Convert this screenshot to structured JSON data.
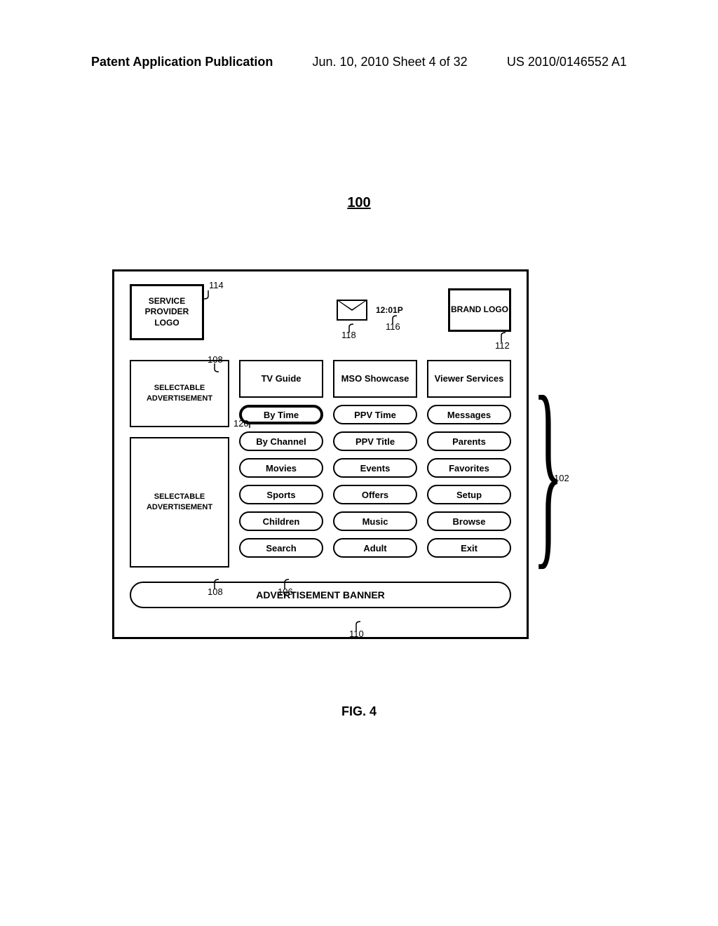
{
  "header": {
    "left": "Patent Application Publication",
    "center": "Jun. 10, 2010  Sheet 4 of 32",
    "right": "US 2010/0146552 A1"
  },
  "figure_ref": "100",
  "figure_label": "FIG. 4",
  "top": {
    "service_logo": "SERVICE PROVIDER LOGO",
    "clock": "12:01P",
    "brand_logo": "BRAND LOGO"
  },
  "ads": {
    "top": "SELECTABLE ADVERTISEMENT",
    "bottom": "SELECTABLE ADVERTISEMENT"
  },
  "columns": [
    {
      "header": "TV Guide",
      "items": [
        "By Time",
        "By Channel",
        "Movies",
        "Sports",
        "Children",
        "Search"
      ],
      "selected_index": 0
    },
    {
      "header": "MSO Showcase",
      "items": [
        "PPV Time",
        "PPV Title",
        "Events",
        "Offers",
        "Music",
        "Adult"
      ],
      "selected_index": -1
    },
    {
      "header": "Viewer Services",
      "items": [
        "Messages",
        "Parents",
        "Favorites",
        "Setup",
        "Browse",
        "Exit"
      ],
      "selected_index": -1
    }
  ],
  "banner": "ADVERTISEMENT BANNER",
  "refs": {
    "r114": "114",
    "r118": "118",
    "r116": "116",
    "r112": "112",
    "r108a": "108",
    "r120": "120",
    "r102": "102",
    "r108b": "108",
    "r106": "106",
    "r110": "110"
  }
}
